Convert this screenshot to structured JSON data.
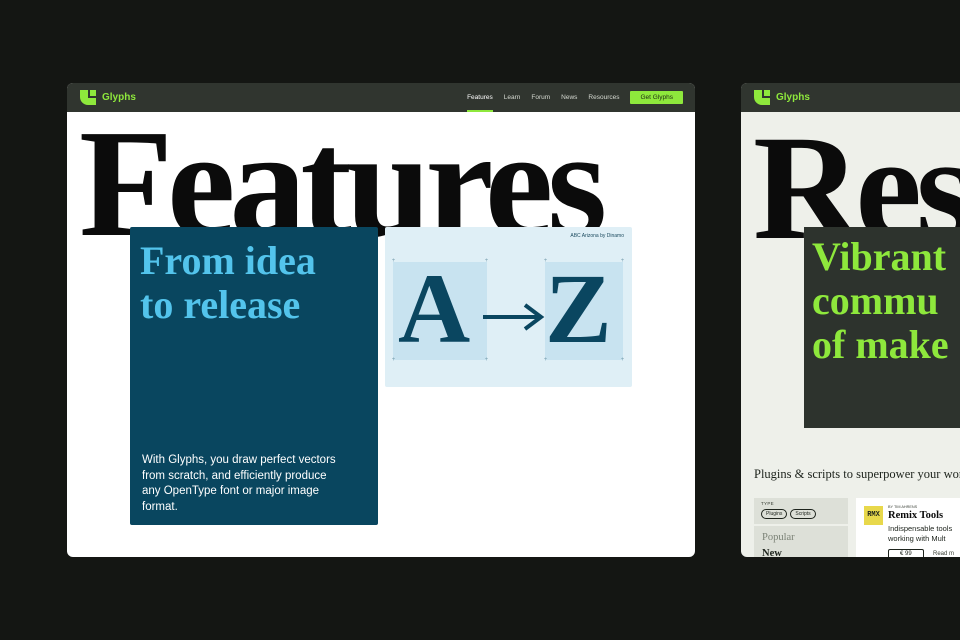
{
  "colors": {
    "background": "#141613",
    "nav": "#30352f",
    "accent_green": "#8ee83c",
    "deep_blue": "#09465f",
    "light_blue": "#53c4ec",
    "glyph_card": "#dfeff6"
  },
  "main_window": {
    "logo": {
      "icon": "glyphs-logo-icon",
      "text": "Glyphs"
    },
    "nav": {
      "links": [
        "Features",
        "Learn",
        "Forum",
        "News",
        "Resources"
      ],
      "active": "Features",
      "cta": "Get Glyphs"
    },
    "hero_title": "Features",
    "blue_card": {
      "title_line1": "From idea",
      "title_line2": "to release",
      "body": "With Glyphs, you draw perfect vectors from scratch, and efficiently produce any OpenType font or major image format."
    },
    "glyph_card": {
      "credit": "ABC Arizona by Dinamo",
      "from_glyph": "A",
      "to_glyph": "Z",
      "arrow_icon": "right-arrow-icon"
    }
  },
  "side_window": {
    "logo": {
      "icon": "glyphs-logo-icon",
      "text": "Glyphs"
    },
    "hero_title": "Res",
    "green_card": {
      "line1": "Vibrant",
      "line2": "commu",
      "line3": "of make"
    },
    "plugins_heading": "Plugins & scripts to superpower your wor",
    "filter": {
      "type_label": "TYPE",
      "pills": [
        "Plugins",
        "Scripts"
      ],
      "sort_options": [
        "Popular",
        "New"
      ],
      "active_sort": "New"
    },
    "plugin": {
      "badge": "RMX",
      "author": "BY TIM AHRENS",
      "name": "Remix Tools",
      "desc_line1": "Indispensable tools",
      "desc_line2": "working with Mult",
      "price": "€ 99",
      "more": "Read m"
    }
  }
}
